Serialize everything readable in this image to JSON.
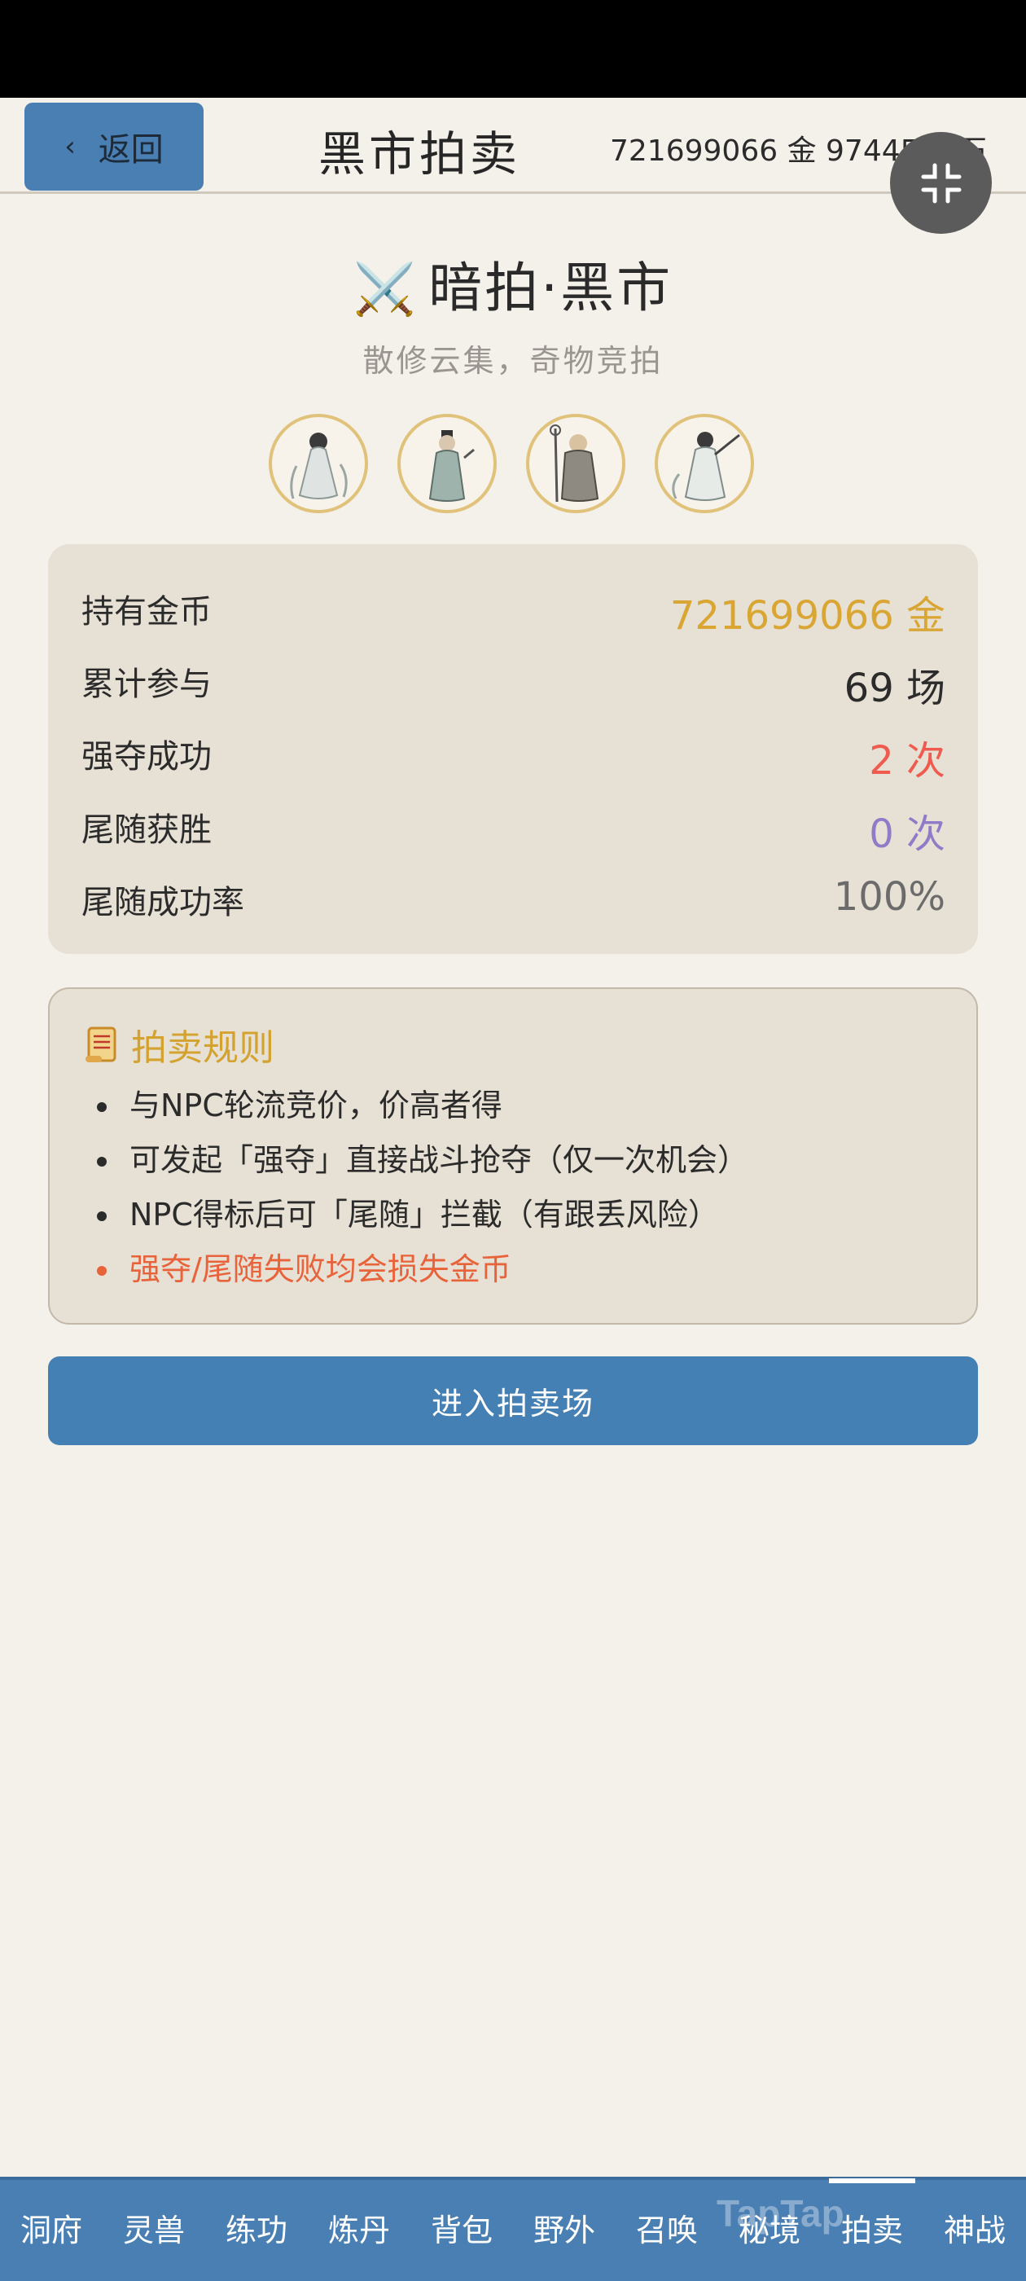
{
  "header": {
    "back_label": "返回",
    "back_icon": "chevron-left-icon",
    "title": "黑市拍卖",
    "currency": "721699066 金  97445 灵石"
  },
  "hero": {
    "title": "暗拍·黑市",
    "emoji": "⚔️",
    "subtitle": "散修云集，奇物竞拍"
  },
  "stats": [
    {
      "label": "持有金币",
      "value": "721699066 金",
      "color": "#d9a634"
    },
    {
      "label": "累计参与",
      "value": "69 场",
      "color": "#2b2b2b"
    },
    {
      "label": "强夺成功",
      "value": "2 次",
      "color": "#ef5c4f"
    },
    {
      "label": "尾随获胜",
      "value": "0 次",
      "color": "#8f7bc8"
    },
    {
      "label": "尾随成功率",
      "value": "100%",
      "color": "#6b6b6b"
    }
  ],
  "rules": {
    "title": "拍卖规则",
    "items": [
      "与NPC轮流竞价，价高者得",
      "可发起「强夺」直接战斗抢夺（仅一次机会）",
      "NPC得标后可「尾随」拦截（有跟丢风险）",
      "强夺/尾随失败均会损失金币"
    ]
  },
  "enter_button": "进入拍卖场",
  "nav": {
    "items": [
      "洞府",
      "灵兽",
      "练功",
      "炼丹",
      "背包",
      "野外",
      "召唤",
      "秘境",
      "拍卖",
      "神战"
    ],
    "active": "拍卖"
  },
  "watermark": "TapTap",
  "colors": {
    "primary": "#4a7fb3",
    "gold": "#d9a634",
    "warn": "#e8623a",
    "background": "#f4f0ea",
    "card": "#e7e0d4"
  }
}
